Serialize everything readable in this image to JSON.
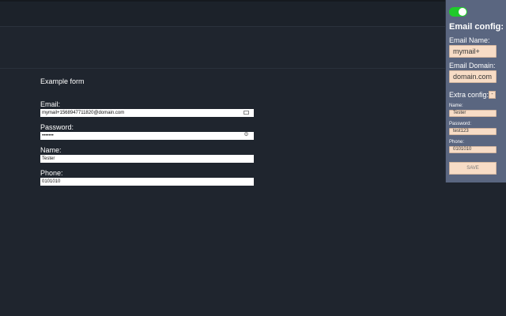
{
  "form": {
    "title": "Example form",
    "email": {
      "label": "Email:",
      "value": "mymail+1568947711820@domain.com"
    },
    "password": {
      "label": "Password:",
      "value": "•••••••"
    },
    "name": {
      "label": "Name:",
      "value": "Tester"
    },
    "phone": {
      "label": "Phone:",
      "value": "0101010"
    }
  },
  "panel": {
    "enabled": true,
    "accent_color": "#1fcb2a",
    "title": "Email config:",
    "email_name": {
      "label": "Email Name:",
      "value": "mymail+"
    },
    "email_domain": {
      "label": "Email Domain:",
      "value": "domain.com"
    },
    "extra": {
      "label": "Extra config:",
      "button": "-"
    },
    "name": {
      "label": "Name:",
      "value": "Tester"
    },
    "password": {
      "label": "Password:",
      "value": "test123"
    },
    "phone": {
      "label": "Phone:",
      "value": "0101010"
    },
    "save_label": "SAVE"
  }
}
